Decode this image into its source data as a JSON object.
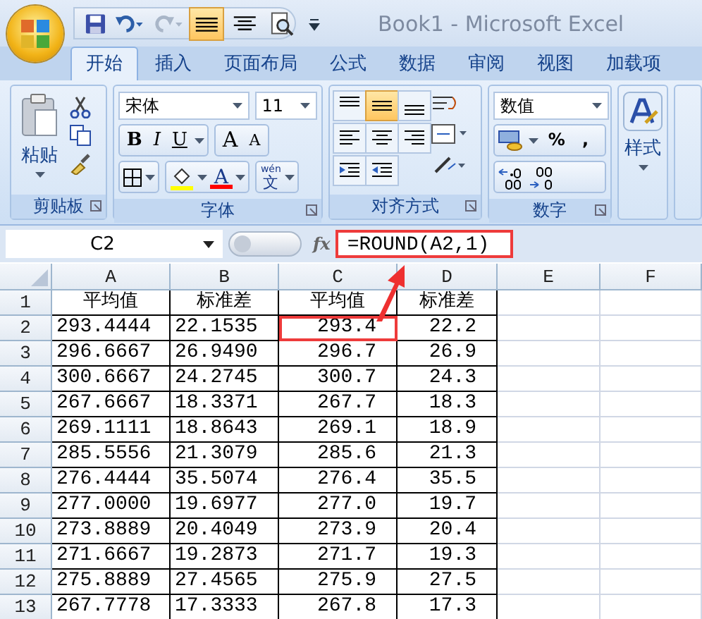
{
  "window": {
    "title": "Book1 - Microsoft Excel"
  },
  "quick_access": [
    {
      "kind": "save"
    },
    {
      "kind": "undo"
    },
    {
      "kind": "redo"
    },
    {
      "kind": "align-middle",
      "selected": true
    },
    {
      "kind": "align-center",
      "selected": false
    },
    {
      "kind": "print-preview",
      "selected": false
    }
  ],
  "tabs": [
    {
      "label": "开始",
      "selected": true
    },
    {
      "label": "插入",
      "selected": false
    },
    {
      "label": "页面布局",
      "selected": false
    },
    {
      "label": "公式",
      "selected": false
    },
    {
      "label": "数据",
      "selected": false
    },
    {
      "label": "审阅",
      "selected": false
    },
    {
      "label": "视图",
      "selected": false
    },
    {
      "label": "加载项",
      "selected": false
    }
  ],
  "ribbon": {
    "clipboard": {
      "label": "剪贴板",
      "paste": "粘贴"
    },
    "font": {
      "label": "字体",
      "font_name": "宋体",
      "font_size": "11",
      "bold": "B",
      "italic": "I",
      "underline": "U",
      "grow": "A",
      "shrink": "A",
      "font_color": "A",
      "phonetic_top": "wén",
      "phonetic": "文"
    },
    "alignment": {
      "label": "对齐方式",
      "buttons": [
        {
          "kind": "top",
          "selected": false
        },
        {
          "kind": "middle",
          "selected": true
        },
        {
          "kind": "bottom",
          "selected": false
        },
        {
          "kind": "left",
          "selected": false
        },
        {
          "kind": "center",
          "selected": false
        },
        {
          "kind": "right",
          "selected": false
        }
      ]
    },
    "number": {
      "label": "数字",
      "format": "数值",
      "percent": "%",
      "comma": ","
    },
    "styles": {
      "label": "样式"
    }
  },
  "formula_bar": {
    "name_box": "C2",
    "fx": "fx",
    "formula": "=ROUND(A2,1)",
    "highlighted": true
  },
  "sheet": {
    "columns": [
      "A",
      "B",
      "C",
      "D",
      "E",
      "F"
    ],
    "rows": [
      {
        "number": "1",
        "kind": "header",
        "cells": [
          {
            "text": "平均值",
            "highlighted": false
          },
          {
            "text": "标准差",
            "highlighted": false
          },
          {
            "text": "平均值",
            "highlighted": false
          },
          {
            "text": "标准差",
            "highlighted": false
          }
        ]
      },
      {
        "number": "2",
        "kind": "data",
        "cells": [
          {
            "text": "293.4444",
            "highlighted": false
          },
          {
            "text": "22.1535",
            "highlighted": false
          },
          {
            "text": "293.4",
            "highlighted": true
          },
          {
            "text": "22.2",
            "highlighted": false
          }
        ]
      },
      {
        "number": "3",
        "kind": "data",
        "cells": [
          {
            "text": "296.6667",
            "highlighted": false
          },
          {
            "text": "26.9490",
            "highlighted": false
          },
          {
            "text": "296.7",
            "highlighted": false
          },
          {
            "text": "26.9",
            "highlighted": false
          }
        ]
      },
      {
        "number": "4",
        "kind": "data",
        "cells": [
          {
            "text": "300.6667",
            "highlighted": false
          },
          {
            "text": "24.2745",
            "highlighted": false
          },
          {
            "text": "300.7",
            "highlighted": false
          },
          {
            "text": "24.3",
            "highlighted": false
          }
        ]
      },
      {
        "number": "5",
        "kind": "data",
        "cells": [
          {
            "text": "267.6667",
            "highlighted": false
          },
          {
            "text": "18.3371",
            "highlighted": false
          },
          {
            "text": "267.7",
            "highlighted": false
          },
          {
            "text": "18.3",
            "highlighted": false
          }
        ]
      },
      {
        "number": "6",
        "kind": "data",
        "cells": [
          {
            "text": "269.1111",
            "highlighted": false
          },
          {
            "text": "18.8643",
            "highlighted": false
          },
          {
            "text": "269.1",
            "highlighted": false
          },
          {
            "text": "18.9",
            "highlighted": false
          }
        ]
      },
      {
        "number": "7",
        "kind": "data",
        "cells": [
          {
            "text": "285.5556",
            "highlighted": false
          },
          {
            "text": "21.3079",
            "highlighted": false
          },
          {
            "text": "285.6",
            "highlighted": false
          },
          {
            "text": "21.3",
            "highlighted": false
          }
        ]
      },
      {
        "number": "8",
        "kind": "data",
        "cells": [
          {
            "text": "276.4444",
            "highlighted": false
          },
          {
            "text": "35.5074",
            "highlighted": false
          },
          {
            "text": "276.4",
            "highlighted": false
          },
          {
            "text": "35.5",
            "highlighted": false
          }
        ]
      },
      {
        "number": "9",
        "kind": "data",
        "cells": [
          {
            "text": "277.0000",
            "highlighted": false
          },
          {
            "text": "19.6977",
            "highlighted": false
          },
          {
            "text": "277.0",
            "highlighted": false
          },
          {
            "text": "19.7",
            "highlighted": false
          }
        ]
      },
      {
        "number": "10",
        "kind": "data",
        "cells": [
          {
            "text": "273.8889",
            "highlighted": false
          },
          {
            "text": "20.4049",
            "highlighted": false
          },
          {
            "text": "273.9",
            "highlighted": false
          },
          {
            "text": "20.4",
            "highlighted": false
          }
        ]
      },
      {
        "number": "11",
        "kind": "data",
        "cells": [
          {
            "text": "271.6667",
            "highlighted": false
          },
          {
            "text": "19.2873",
            "highlighted": false
          },
          {
            "text": "271.7",
            "highlighted": false
          },
          {
            "text": "19.3",
            "highlighted": false
          }
        ]
      },
      {
        "number": "12",
        "kind": "data",
        "cells": [
          {
            "text": "275.8889",
            "highlighted": false
          },
          {
            "text": "27.4565",
            "highlighted": false
          },
          {
            "text": "275.9",
            "highlighted": false
          },
          {
            "text": "27.5",
            "highlighted": false
          }
        ]
      },
      {
        "number": "13",
        "kind": "data",
        "cells": [
          {
            "text": "267.7778",
            "highlighted": false
          },
          {
            "text": "17.3333",
            "highlighted": false
          },
          {
            "text": "267.8",
            "highlighted": false
          },
          {
            "text": "17.3",
            "highlighted": false
          }
        ]
      }
    ]
  }
}
